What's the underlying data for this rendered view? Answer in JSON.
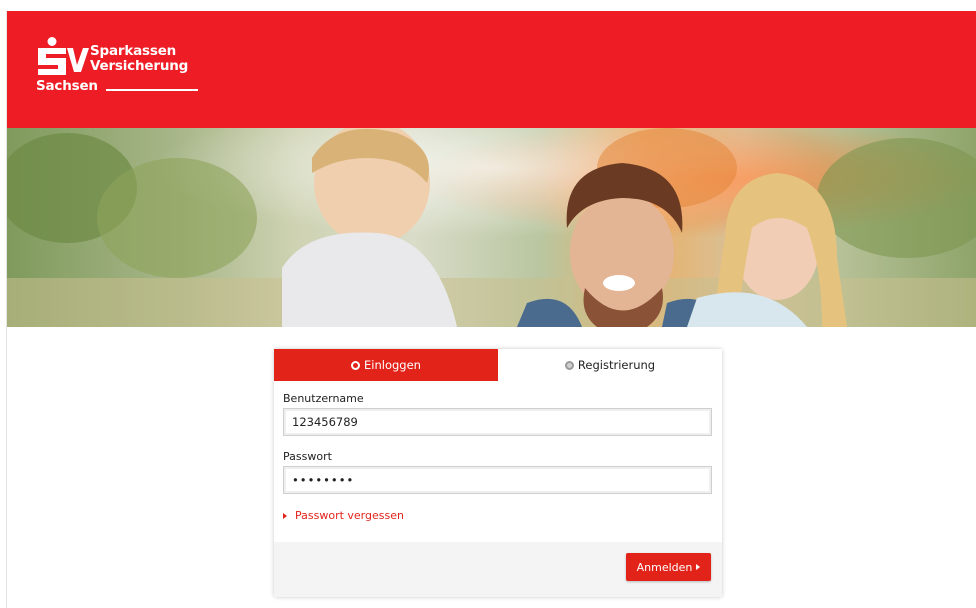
{
  "brand": {
    "logo_line1": "Sparkassen",
    "logo_line2": "Versicherung",
    "logo_region": "Sachsen",
    "header_color": "#ee1c25"
  },
  "hero": {
    "icon": "family-photo"
  },
  "login": {
    "tabs": [
      {
        "label": "Einloggen",
        "active": true,
        "icon": "radio-active-icon"
      },
      {
        "label": "Registrierung",
        "active": false,
        "icon": "radio-inactive-icon"
      }
    ],
    "username_label": "Benutzername",
    "username_value": "123456789",
    "password_label": "Passwort",
    "password_value": "••••••••",
    "forgot_link": "Passwort vergessen",
    "submit_label": "Anmelden",
    "accent_color": "#e2231a"
  }
}
